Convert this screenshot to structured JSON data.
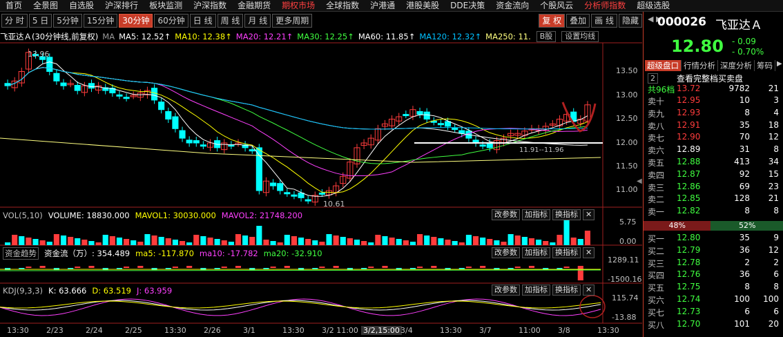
{
  "top_menu": [
    "首页",
    "全景图",
    "自选股",
    "沪深排行",
    "板块监测",
    "沪深指数",
    "金融期货",
    "期权市场",
    "全球指数",
    "沪港通",
    "港股美股",
    "DDE决策",
    "资金流向",
    "个股风云",
    "分析师指数",
    "超级选股"
  ],
  "top_menu_active": [
    "期权市场",
    "分析师指数"
  ],
  "toolbar": {
    "periods": [
      "分 时",
      "5 日",
      "5分钟",
      "15分钟",
      "30分钟",
      "60分钟",
      "日 线",
      "周 线",
      "月 线",
      "更多周期"
    ],
    "selected": "30分钟",
    "right": [
      "复 权",
      "叠加",
      "画 线",
      "隐藏"
    ]
  },
  "chart_header": {
    "name": "飞亚达Ａ",
    "desc": "(30分钟线,前复权)",
    "ma_toggle": "MA",
    "ma5": "MA5: 12.52",
    "ma10": "MA10: 12.38",
    "ma20": "MA20: 12.21",
    "ma30": "MA30: 12.25",
    "ma60": "MA60: 11.85",
    "ma120": "MA120: 12.32",
    "ma250": "MA250: 11.",
    "b_btn": "B股",
    "set_btn": "设置均线"
  },
  "price_axis": [
    "13.50",
    "13.00",
    "12.50",
    "12.00",
    "11.50",
    "11.00"
  ],
  "annotations": {
    "high": "13.96",
    "low": "10.61",
    "mid": "11.91--11.96"
  },
  "volume": {
    "label": "VOL(5,10)",
    "volume": "VOLUME: 18830.000",
    "mavol1": "MAVOL1: 30030.000",
    "mavol2": "MAVOL2: 21748.200",
    "axis": [
      "5.75",
      "0.00"
    ]
  },
  "funds": {
    "label": "资金趋势",
    "flow": "资金流（万）: 354.489",
    "ma5": "ma5: -117.870",
    "ma10": "ma10: -17.782",
    "ma20": "ma20: -32.910",
    "axis": [
      "1289.11",
      "-1500.16"
    ]
  },
  "kdj": {
    "label": "KDJ(9,3,3)",
    "k": "K: 63.666",
    "d": "D: 63.519",
    "j": "J: 63.959",
    "axis": [
      "115.74",
      "-13.88"
    ]
  },
  "panel_buttons": [
    "改参数",
    "加指标",
    "换指标"
  ],
  "x_axis": [
    "13:30",
    "2/23",
    "2/24",
    "2/25",
    "13:30",
    "2/26",
    "3/1",
    "13:30",
    "3/2 11:00",
    "3/2,15:00",
    "3/4",
    "13:30",
    "3/7",
    "11:00",
    "3/8",
    "13:30"
  ],
  "quote": {
    "code": "000026",
    "name": "飞亚达Ａ",
    "price": "12.80",
    "change": "- 0.09",
    "pct": "- 0.70%",
    "tabs": [
      "超级盘口",
      "行情分析",
      "深度分析",
      "筹码"
    ],
    "count": "2",
    "full_book": "查看完整档买卖盘",
    "total": {
      "label": "共96档",
      "price": "13.72",
      "vol": "9782",
      "n": "21"
    }
  },
  "asks": [
    {
      "label": "卖十",
      "price": "12.95",
      "vol": "10",
      "n": "3"
    },
    {
      "label": "卖九",
      "price": "12.93",
      "vol": "8",
      "n": "4"
    },
    {
      "label": "卖八",
      "price": "12.91",
      "vol": "35",
      "n": "18"
    },
    {
      "label": "卖七",
      "price": "12.90",
      "vol": "70",
      "n": "12"
    },
    {
      "label": "卖六",
      "price": "12.89",
      "vol": "31",
      "n": "8"
    },
    {
      "label": "卖五",
      "price": "12.88",
      "vol": "413",
      "n": "34"
    },
    {
      "label": "卖四",
      "price": "12.87",
      "vol": "92",
      "n": "15"
    },
    {
      "label": "卖三",
      "price": "12.86",
      "vol": "69",
      "n": "23"
    },
    {
      "label": "卖二",
      "price": "12.85",
      "vol": "128",
      "n": "21"
    },
    {
      "label": "卖一",
      "price": "12.82",
      "vol": "8",
      "n": "8"
    }
  ],
  "ratio": {
    "sell": "48%",
    "buy": "52%",
    "sell_frac": 0.48
  },
  "bids": [
    {
      "label": "买一",
      "price": "12.80",
      "vol": "35",
      "n": "9"
    },
    {
      "label": "买二",
      "price": "12.79",
      "vol": "36",
      "n": "12"
    },
    {
      "label": "买三",
      "price": "12.78",
      "vol": "2",
      "n": "2"
    },
    {
      "label": "买四",
      "price": "12.76",
      "vol": "36",
      "n": "6"
    },
    {
      "label": "买五",
      "price": "12.75",
      "vol": "8",
      "n": "8"
    },
    {
      "label": "买六",
      "price": "12.74",
      "vol": "100",
      "n": "100"
    },
    {
      "label": "买七",
      "price": "12.73",
      "vol": "6",
      "n": "6"
    },
    {
      "label": "买八",
      "price": "12.70",
      "vol": "101",
      "n": "20"
    }
  ],
  "colors": {
    "up": "#ff3c3c",
    "down": "#00ffff",
    "ma5": "#ffffff",
    "ma10": "#ffff00",
    "ma20": "#ff40ff",
    "ma30": "#40ff40",
    "ma120": "#00c0ff",
    "ma250": "#ffff80",
    "accent": "#c83c28"
  }
}
